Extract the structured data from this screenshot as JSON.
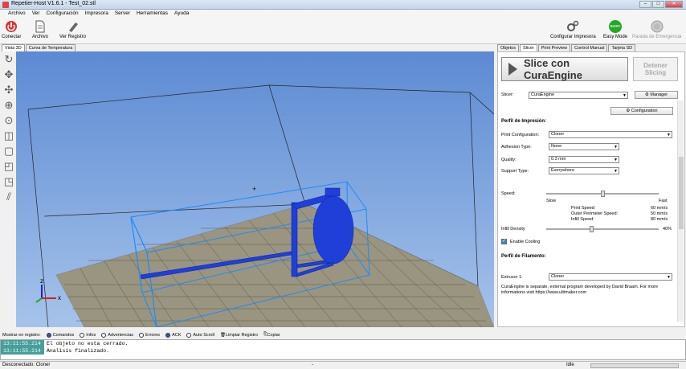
{
  "window": {
    "title": "Repetier-Host V1.6.1 - Test_02.stl"
  },
  "menu": [
    "Archivo",
    "Ver",
    "Configuración",
    "Impresora",
    "Server",
    "Herramientas",
    "Ayuda"
  ],
  "toolbar": {
    "connect": "Conectar",
    "file": "Archivo",
    "log": "Ver Registro",
    "printer_config": "Configurar Impresora",
    "easy_mode": "Easy Mode",
    "easy_badge": "EASY",
    "emergency": "Parada de Emergencia"
  },
  "left_tabs": [
    "Vista 3D",
    "Curva de Temperatura"
  ],
  "right_tabs": [
    "Objetos",
    "Slicer",
    "Print Preview",
    "Control Manual",
    "Tarjeta SD"
  ],
  "slicer": {
    "slice_button": "Slice con CuraEngine",
    "stop_button": "Detener Slicing",
    "slicer_label": "Slicer:",
    "slicer_value": "CuraEngine",
    "manager": "Manager",
    "configuration": "Configuration",
    "print_profile": "Perfil de Impresión:",
    "print_config_label": "Print Configuration:",
    "print_config_value": "Cloner",
    "adhesion_label": "Adhesion Type:",
    "adhesion_value": "None",
    "quality_label": "Quality:",
    "quality_value": "0.3 mm",
    "support_label": "Support Type:",
    "support_value": "Everywhere",
    "speed_label": "Speed:",
    "slow": "Slow",
    "fast": "Fast",
    "print_speed_label": "Print Speed:",
    "print_speed": "60 mm/s",
    "outer_speed_label": "Outer Perimeter Speed:",
    "outer_speed": "50 mm/s",
    "infill_speed_label": "Infill Speed:",
    "infill_speed": "80 mm/s",
    "infill_label": "Infill Density",
    "infill_value": "40%",
    "infill_fraction": 0.4,
    "speed_fraction": 0.5,
    "cooling": "Enable Cooling",
    "filament_profile": "Perfil de Filamento:",
    "extruder_label": "Extrusor 1:",
    "extruder_value": "Cloner",
    "note": "CuraEngine is separate, external program developed by David Braam. For more informations visit https://www.ultimaker.com"
  },
  "logbar": {
    "label": "Mostrar en registro:",
    "items": [
      "Comandos",
      "Infos",
      "Advertencias",
      "Errores",
      "ACK",
      "Auto Scroll",
      "Limpiar Registro",
      "Copiar"
    ]
  },
  "log": [
    {
      "time": "13:11:55.214",
      "msg": "El objeto no esta cerrado."
    },
    {
      "time": "13:11:55.214",
      "msg": "Analisis finalizado."
    }
  ],
  "status": {
    "left": "Desconectado: Cloner",
    "center": "-",
    "right": "Idle"
  },
  "colors": {
    "accent": "#1f3fd8",
    "viewport_top": "#5c8ad3",
    "easy": "#22aa22"
  }
}
